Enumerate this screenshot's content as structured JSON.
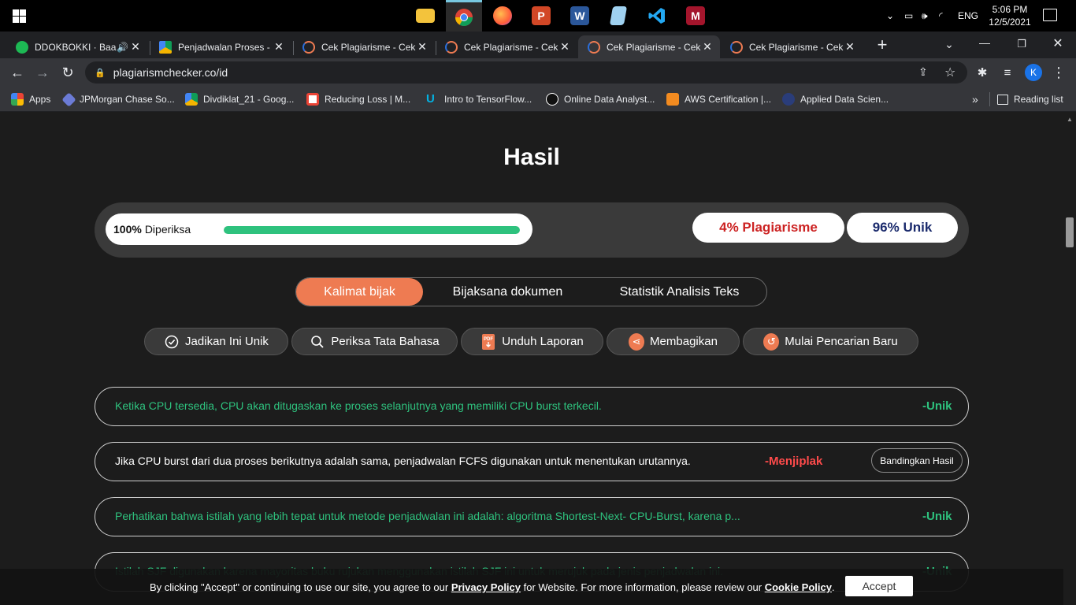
{
  "taskbar": {
    "apps": [
      "file-explorer",
      "chrome",
      "firefox",
      "powerpoint",
      "word",
      "notepad",
      "vscode",
      "mendeley"
    ],
    "language": "ENG",
    "time": "5:06 PM",
    "date": "12/5/2021"
  },
  "browser": {
    "tabs": [
      {
        "title": "DDOKBOKKI · Baa",
        "icon": "spotify-icon"
      },
      {
        "title": "Penjadwalan Proses - G",
        "icon": "google-drive-icon"
      },
      {
        "title": "Cek Plagiarisme - Cek",
        "icon": "plagiarism-checker-icon"
      },
      {
        "title": "Cek Plagiarisme - Cek",
        "icon": "plagiarism-checker-icon"
      },
      {
        "title": "Cek Plagiarisme - Cek",
        "icon": "plagiarism-checker-icon",
        "active": true
      },
      {
        "title": "Cek Plagiarisme - Cek",
        "icon": "plagiarism-checker-icon"
      }
    ],
    "url": "plagiarismchecker.co/id",
    "profile_initial": "K",
    "bookmarks": [
      {
        "label": "Apps"
      },
      {
        "label": "JPMorgan Chase So..."
      },
      {
        "label": "Divdiklat_21 - Goog..."
      },
      {
        "label": "Reducing Loss  |  M..."
      },
      {
        "label": "Intro to TensorFlow..."
      },
      {
        "label": "Online Data Analyst..."
      },
      {
        "label": "AWS Certification |..."
      },
      {
        "label": "Applied Data  Scien..."
      }
    ],
    "reading_list": "Reading list",
    "more_bookmarks": "»"
  },
  "page": {
    "title": "Hasil",
    "progress": {
      "percent_label": "100%",
      "label": "Diperiksa",
      "value": 1.0
    },
    "plagiarism_label": "4% Plagiarisme",
    "unique_label": "96% Unik",
    "view_tabs": [
      "Kalimat bijak",
      "Bijaksana dokumen",
      "Statistik Analisis Teks"
    ],
    "actions": [
      "Jadikan Ini Unik",
      "Periksa Tata Bahasa",
      "Unduh Laporan",
      "Membagikan",
      "Mulai Pencarian Baru"
    ],
    "sentences": [
      {
        "text": "Ketika CPU tersedia, CPU akan ditugaskan ke proses selanjutnya yang memiliki CPU burst terkecil.",
        "status": "-Unik",
        "type": "unique"
      },
      {
        "text": "Jika CPU burst dari dua proses berikutnya adalah sama, penjadwalan FCFS digunakan untuk menentukan urutannya.",
        "status": "-Menjiplak",
        "type": "plagiarized",
        "compare_label": "Bandingkan Hasil"
      },
      {
        "text": "Perhatikan bahwa istilah yang lebih tepat untuk metode penjadwalan ini adalah: algoritma Shortest-Next- CPU-Burst, karena p...",
        "status": "-Unik",
        "type": "unique"
      },
      {
        "text": "Istilah SJF digunakan karena mayoritas buku rujukan menggunakan istilah SJF ini untuk merujuk pada jenis penjadwalan ini.",
        "status": "-Unik",
        "type": "unique"
      }
    ],
    "cookie": {
      "text_before": "By clicking \"Accept\" or continuing to use our site, you agree to our ",
      "privacy_link": "Privacy Policy",
      "text_middle": " for Website. For more information, please review our ",
      "cookie_link": "Cookie Policy",
      "text_after": ".",
      "accept_label": "Accept"
    }
  },
  "colors": {
    "accent": "#ee7b52",
    "unique": "#2ec27e",
    "plagiarism": "#cc2222",
    "unique_score": "#1a2a6c"
  }
}
